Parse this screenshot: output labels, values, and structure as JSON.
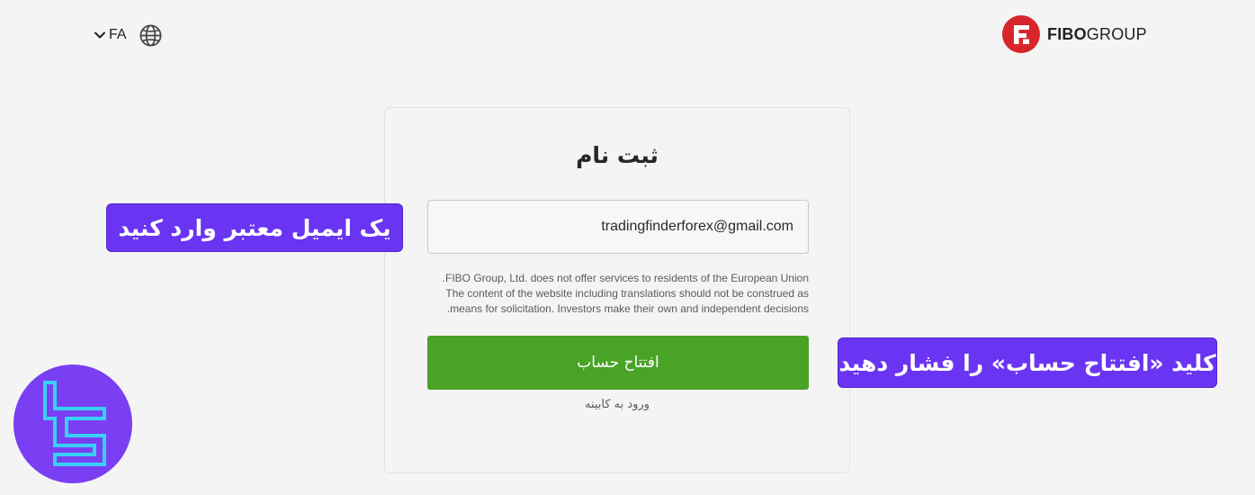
{
  "header": {
    "language_code": "FA",
    "brand": {
      "bold": "FIBO",
      "regular": "GROUP"
    }
  },
  "form": {
    "title": "ثبت نام",
    "email_value": "tradingfinderforex@gmail.com",
    "disclaimer_lines": [
      "FIBO Group, Ltd. does not offer services to residents of the European Union.",
      "The content of the website including translations should not be construed as",
      "means for solicitation. Investors make their own and independent decisions."
    ],
    "submit_label": "افتتاح حساب",
    "login_link": "ورود به کابینه"
  },
  "annotations": {
    "email_tip": "یک ایمیل معتبر وارد کنید",
    "button_tip": "کلید «افتتاح حساب» را فشار دهید"
  },
  "icons": {
    "language_dropdown": "chevron-down-icon",
    "language_globe": "globe-icon",
    "brand_logo": "fibo-logo-icon",
    "watermark": "tradingfinder-logo-icon"
  },
  "colors": {
    "background": "#f4f4f4",
    "primary_button": "#49a326",
    "brand_red": "#d7262b",
    "annotation_purple": "#6a35f2",
    "watermark_purple": "#7a3ff2",
    "watermark_cyan": "#39d0f5"
  }
}
